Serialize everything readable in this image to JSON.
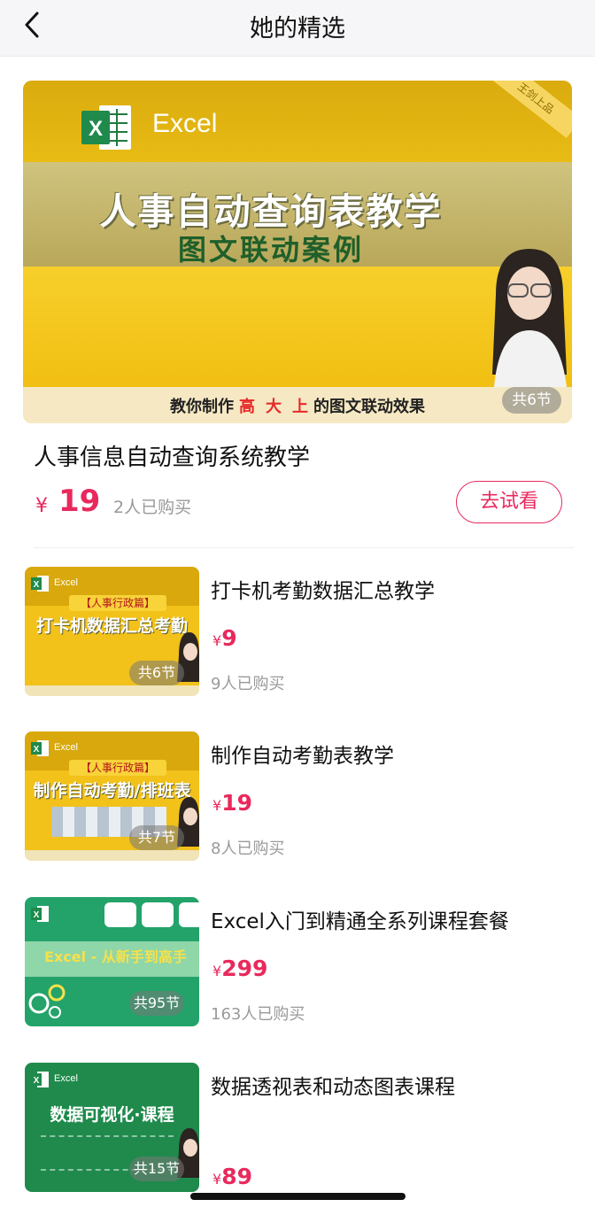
{
  "nav": {
    "title": "她的精选"
  },
  "hero": {
    "brand": "Excel",
    "ribbon": "王剑上品",
    "banner_title": "人事自动查询表教学",
    "banner_subtitle": "图文联动案例",
    "strip_prefix": "教你制作",
    "strip_highlight_1": "高",
    "strip_highlight_2": "大",
    "strip_highlight_3": "上",
    "strip_suffix": "的图文联动效果",
    "lessons": "共6节",
    "name": "人事信息自动查询系统教学",
    "price_symbol": "¥",
    "price": "19",
    "buyers": "2人已购买",
    "trial_label": "去试看"
  },
  "courses": [
    {
      "name": "打卡机考勤数据汇总教学",
      "price_symbol": "¥",
      "price": "9",
      "buyers": "9人已购买",
      "lessons": "共6节",
      "thumb_brand": "Excel",
      "thumb_tag": "【人事行政篇】",
      "thumb_title": "打卡机数据汇总考勤"
    },
    {
      "name": "制作自动考勤表教学",
      "price_symbol": "¥",
      "price": "19",
      "buyers": "8人已购买",
      "lessons": "共7节",
      "thumb_brand": "Excel",
      "thumb_tag": "【人事行政篇】",
      "thumb_title": "制作自动考勤/排班表"
    },
    {
      "name": "Excel入门到精通全系列课程套餐",
      "price_symbol": "¥",
      "price": "299",
      "buyers": "163人已购买",
      "lessons": "共95节",
      "thumb_title": "Excel - 从新手到高手"
    },
    {
      "name": "数据透视表和动态图表课程",
      "price_symbol": "¥",
      "price": "89",
      "lessons": "共15节",
      "thumb_brand": "Excel",
      "thumb_title": "数据可视化·课程"
    }
  ],
  "colors": {
    "accent": "#e8295d",
    "banner_yellow": "#f3c51d",
    "excel_green": "#1f8a4c"
  }
}
